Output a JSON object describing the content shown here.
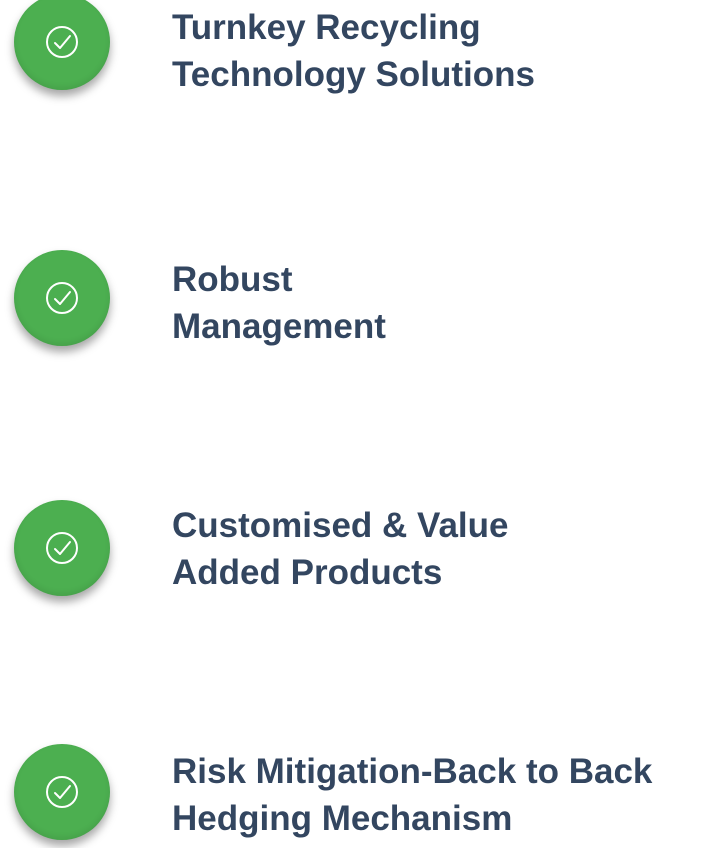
{
  "features": [
    {
      "line1": "Turnkey Recycling",
      "line2": "Technology Solutions",
      "icon": "check-circle-icon"
    },
    {
      "line1": "Robust",
      "line2": "Management",
      "icon": "check-circle-icon"
    },
    {
      "line1": "Customised & Value",
      "line2": "Added Products",
      "icon": "check-circle-icon"
    },
    {
      "line1": "Risk Mitigation-Back to Back",
      "line2": "Hedging Mechanism",
      "icon": "check-circle-icon"
    }
  ],
  "colors": {
    "badge": "#4caf50",
    "text": "#334660",
    "background": "#ffffff"
  }
}
